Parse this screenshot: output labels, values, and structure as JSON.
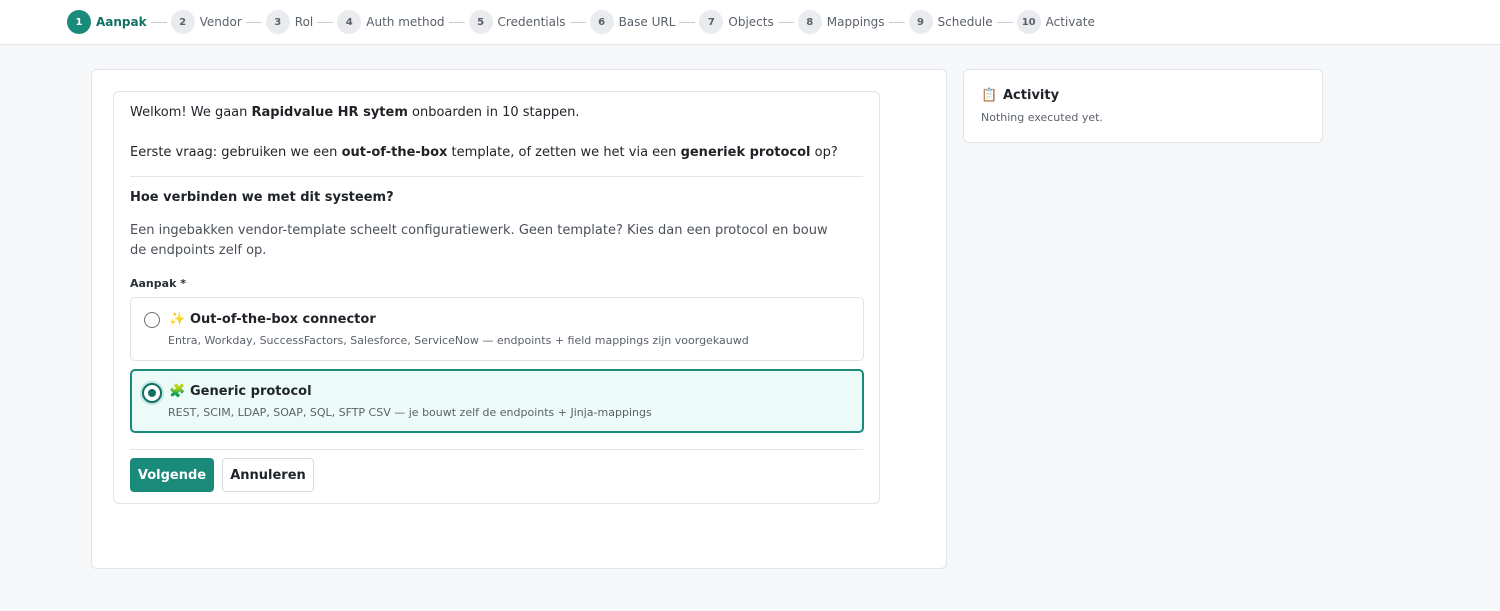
{
  "stepper": {
    "steps": [
      {
        "num": "1",
        "label": "Aanpak"
      },
      {
        "num": "2",
        "label": "Vendor"
      },
      {
        "num": "3",
        "label": "Rol"
      },
      {
        "num": "4",
        "label": "Auth method"
      },
      {
        "num": "5",
        "label": "Credentials"
      },
      {
        "num": "6",
        "label": "Base URL"
      },
      {
        "num": "7",
        "label": "Objects"
      },
      {
        "num": "8",
        "label": "Mappings"
      },
      {
        "num": "9",
        "label": "Schedule"
      },
      {
        "num": "10",
        "label": "Activate"
      }
    ],
    "active_step": "1"
  },
  "intro": {
    "line1_pre": "Welkom! We gaan ",
    "line1_bold": "Rapidvalue HR sytem",
    "line1_post": " onboarden in 10 stappen.",
    "line2_pre": "Eerste vraag: gebruiken we een ",
    "line2_bold1": "out-of-the-box",
    "line2_mid": " template, of zetten we het via een ",
    "line2_bold2": "generiek protocol",
    "line2_post": " op?"
  },
  "question": {
    "title": "Hoe verbinden we met dit systeem?",
    "description": "Een ingebakken vendor-template scheelt configuratiewerk. Geen template? Kies dan een protocol en bouw de endpoints zelf op.",
    "field_label": "Aanpak *"
  },
  "options": [
    {
      "icon": "sparkles-icon",
      "icon_glyph": "✨",
      "title": "Out-of-the-box connector",
      "subtitle": "Entra, Workday, SuccessFactors, Salesforce, ServiceNow — endpoints + field mappings zijn voorgekauwd",
      "selected": false
    },
    {
      "icon": "puzzle-icon",
      "icon_glyph": "🧩",
      "title": "Generic protocol",
      "subtitle": "REST, SCIM, LDAP, SOAP, SQL, SFTP CSV — je bouwt zelf de endpoints + Jinja-mappings",
      "selected": true
    }
  ],
  "buttons": {
    "next_label": "Volgende",
    "cancel_label": "Annuleren"
  },
  "activity": {
    "icon": "clipboard-icon",
    "icon_glyph": "📋",
    "title": "Activity",
    "empty_text": "Nothing executed yet."
  },
  "colors": {
    "accent": "#1a8a7a",
    "accent_dark": "#147064",
    "selected_bg": "#ecfbf8"
  }
}
